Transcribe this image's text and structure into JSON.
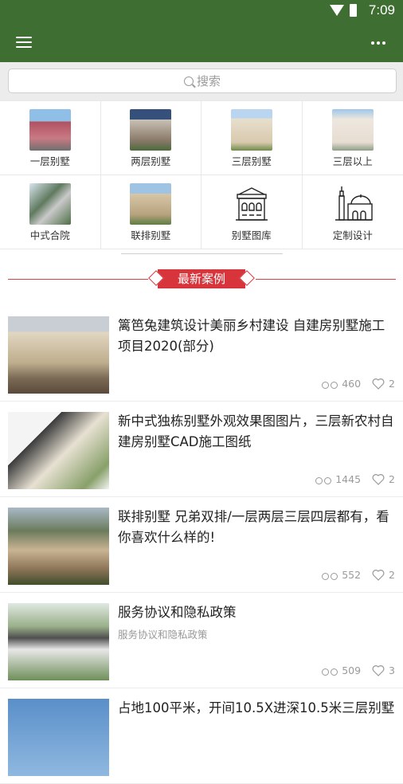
{
  "status_bar": {
    "time": "7:09"
  },
  "search": {
    "placeholder": "搜索"
  },
  "categories": [
    {
      "label": "一层别墅",
      "icon": "photo-thumbnail"
    },
    {
      "label": "两层别墅",
      "icon": "photo-thumbnail"
    },
    {
      "label": "三层别墅",
      "icon": "photo-thumbnail"
    },
    {
      "label": "三层以上",
      "icon": "photo-thumbnail"
    },
    {
      "label": "中式合院",
      "icon": "photo-thumbnail"
    },
    {
      "label": "联排别墅",
      "icon": "photo-thumbnail"
    },
    {
      "label": "别墅图库",
      "icon": "villa-line-icon"
    },
    {
      "label": "定制设计",
      "icon": "mosque-line-icon"
    }
  ],
  "section": {
    "title": "最新案例"
  },
  "articles": [
    {
      "title": "篱笆兔建筑设计美丽乡村建设 自建房别墅施工项目2020(部分)",
      "subtitle": "",
      "views": "460",
      "likes": "2"
    },
    {
      "title": "新中式独栋别墅外观效果图图片，三层新农村自建房别墅CAD施工图纸",
      "subtitle": "",
      "views": "1445",
      "likes": "2"
    },
    {
      "title": "联排别墅 兄弟双排/一层两层三层四层都有，看你喜欢什么样的!",
      "subtitle": "",
      "views": "552",
      "likes": "2"
    },
    {
      "title": "服务协议和隐私政策",
      "subtitle": "服务协议和隐私政策",
      "views": "509",
      "likes": "3"
    },
    {
      "title": "占地100平米，开间10.5X进深10.5米三层别墅",
      "subtitle": "",
      "views": "",
      "likes": ""
    }
  ]
}
